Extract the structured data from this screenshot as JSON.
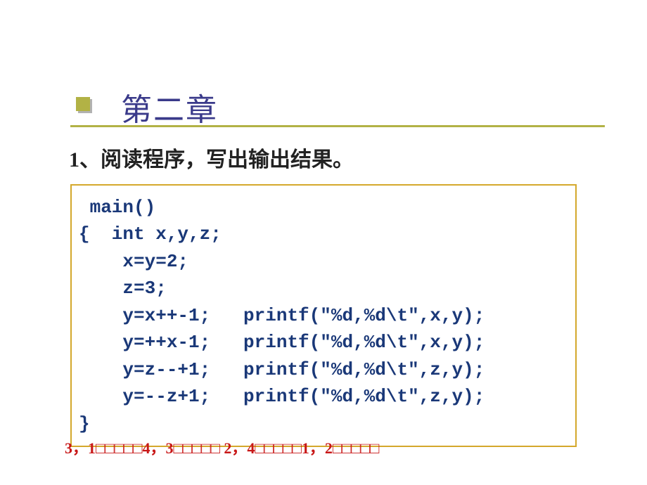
{
  "title": "第二章",
  "question": {
    "number": "1",
    "sep": "、",
    "text": "阅读程序，写出输出结果。"
  },
  "code": {
    "l1": " main()",
    "l2": "{  int x,y,z;",
    "l3": "    x=y=2;",
    "l4": "    z=3;",
    "l5": "    y=x++-1;   printf(\"%d,%d\\t\",x,y);",
    "l6": "    y=++x-1;   printf(\"%d,%d\\t\",x,y);",
    "l7": "    y=z--+1;   printf(\"%d,%d\\t\",z,y);",
    "l8": "    y=--z+1;   printf(\"%d,%d\\t\",z,y);",
    "l9": "}"
  },
  "answer": "3，1□□□□□4，3□□□□□ 2，4□□□□□1，2□□□□□"
}
